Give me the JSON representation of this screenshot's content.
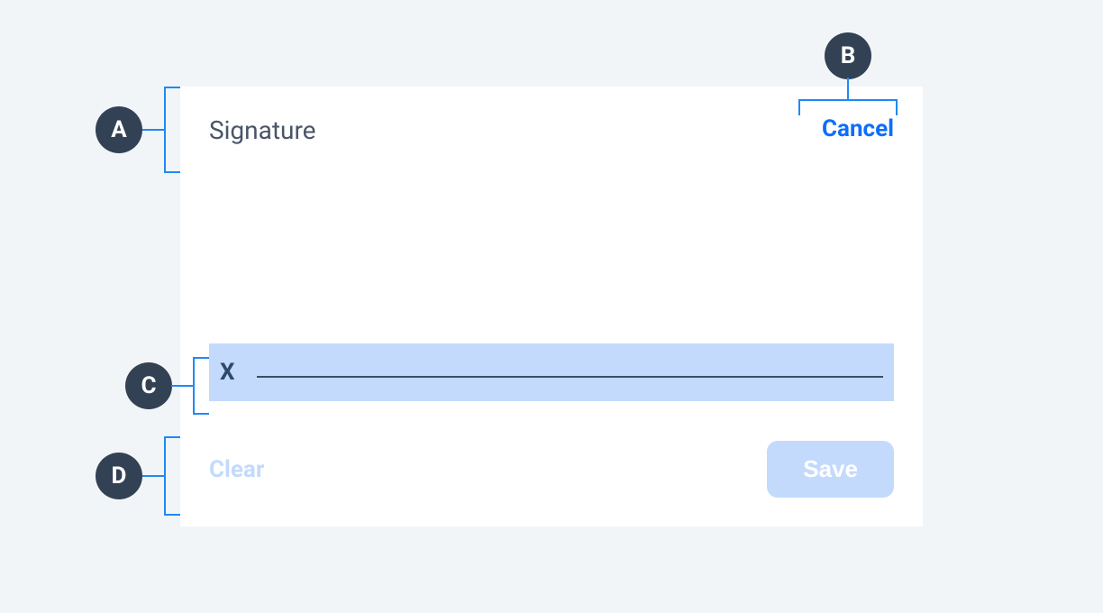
{
  "annotations": {
    "a": "A",
    "b": "B",
    "c": "C",
    "d": "D"
  },
  "modal": {
    "title": "Signature",
    "cancel": "Cancel",
    "sig_marker": "X",
    "clear": "Clear",
    "save": "Save"
  },
  "colors": {
    "accent": "#0d6efd",
    "callout_bg": "#334155",
    "highlight": "#c3dafc",
    "bracket": "#1d8af5"
  }
}
